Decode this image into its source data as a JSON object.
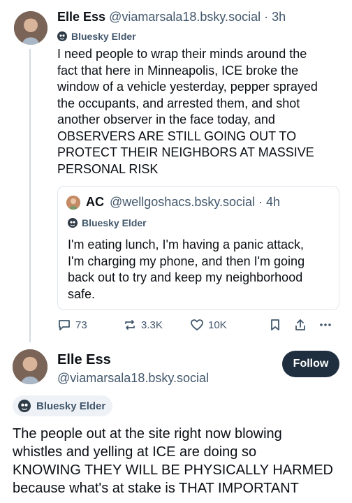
{
  "parent_post": {
    "author_name": "Elle Ess",
    "author_handle": "@viamarsala18.bsky.social · 3h",
    "badge": "Bluesky Elder",
    "text": "I need people to wrap their minds around the\nfact that here in Minneapolis, ICE broke the\nwindow of a vehicle yesterday, pepper sprayed\nthe occupants, and arrested them, and shot\nanother observer in the face today, and\nOBSERVERS ARE STILL GOING OUT TO\nPROTECT THEIR NEIGHBORS AT MASSIVE\nPERSONAL RISK",
    "quote": {
      "author_name": "AC",
      "author_handle": "@wellgoshacs.bsky.social · 4h",
      "badge": "Bluesky Elder",
      "text": "I'm eating lunch, I'm having a panic attack,\nI'm charging my phone, and then I'm going\nback out to try and keep my neighborhood\nsafe."
    },
    "actions": {
      "replies": "73",
      "reposts": "3.3K",
      "likes": "10K"
    }
  },
  "main_post": {
    "author_name": "Elle Ess",
    "author_handle": "@viamarsala18.bsky.social",
    "follow_label": "Follow",
    "badge": "Bluesky Elder",
    "text": "The people out at the site right now blowing\nwhistles and yelling at ICE are doing so\nKNOWING THEY WILL BE PHYSICALLY HARMED\nbecause what's at stake is THAT IMPORTANT"
  },
  "icons": {
    "reply": "reply-icon",
    "repost": "repost-icon",
    "like": "heart-icon",
    "bookmark": "bookmark-icon",
    "share": "share-icon",
    "more": "more-icon",
    "badge": "elder-badge-icon"
  },
  "colors": {
    "text": "#0b0f14",
    "muted": "#42576c",
    "follow_bg": "#1f2f3f",
    "border": "#e0e6ec"
  }
}
